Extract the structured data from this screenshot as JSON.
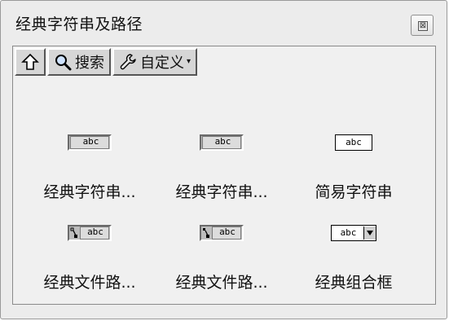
{
  "window": {
    "title": "经典字符串及路径",
    "close_glyph": "⊠"
  },
  "toolbar": {
    "up_icon": "up-arrow",
    "search_icon": "magnifier",
    "search_label": "搜索",
    "customize_icon": "wrench",
    "customize_label": "自定义",
    "customize_dropdown": "▾"
  },
  "items": [
    {
      "label": "经典字符串...",
      "control": "classic-string",
      "sample": "abc"
    },
    {
      "label": "经典字符串...",
      "control": "classic-string",
      "sample": "abc"
    },
    {
      "label": "简易字符串",
      "control": "simple-string",
      "sample": "abc"
    },
    {
      "label": "经典文件路...",
      "control": "classic-path",
      "sample": "abc"
    },
    {
      "label": "经典文件路...",
      "control": "classic-path",
      "sample": "abc"
    },
    {
      "label": "经典组合框",
      "control": "classic-combo",
      "sample": "abc"
    }
  ]
}
